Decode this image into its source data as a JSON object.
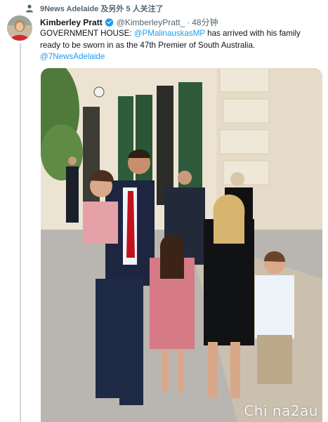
{
  "social_context": {
    "text": "9News Adelaide 及另外 5 人关注了",
    "icon": "person-icon"
  },
  "tweet": {
    "display_name": "Kimberley Pratt",
    "verified_icon": "verified-badge-icon",
    "handle": "@KimberleyPratt_",
    "separator": "·",
    "time": "48分钟",
    "text_part1": "GOVERNMENT HOUSE: ",
    "mention": "@PMalinauskasMP",
    "text_part2": " has arrived with his family ready to be sworn in as the 47th Premier of South Australia.",
    "hashtag_link": "@7NewsAdelaide"
  },
  "media": {
    "watermark": "Chi na2au"
  },
  "colors": {
    "link": "#1d9bf0",
    "muted": "#536471",
    "verified": "#1d9bf0",
    "thread_line": "#cfd9de"
  }
}
